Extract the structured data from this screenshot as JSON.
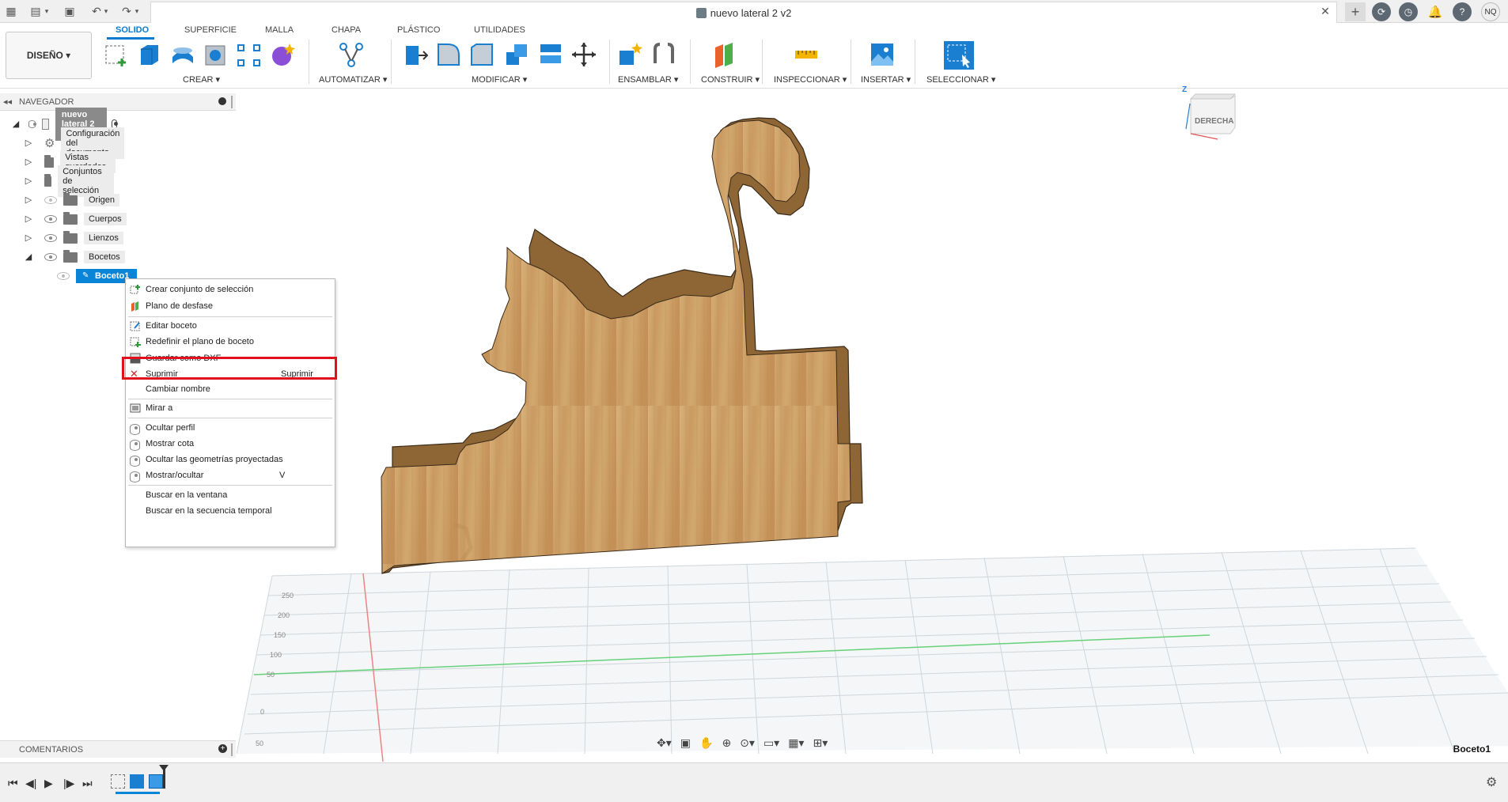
{
  "window": {
    "document_title": "nuevo lateral 2 v2",
    "user_initials": "NQ"
  },
  "toolbar": {
    "workspace": "DISEÑO ▾",
    "tabs": [
      "SOLIDO",
      "SUPERFICIE",
      "MALLA",
      "CHAPA",
      "PLÁSTICO",
      "UTILIDADES"
    ],
    "groups": [
      "CREAR ▾",
      "AUTOMATIZAR ▾",
      "MODIFICAR ▾",
      "ENSAMBLAR ▾",
      "CONSTRUIR ▾",
      "INSPECCIONAR ▾",
      "INSERTAR ▾",
      "SELECCIONAR ▾"
    ]
  },
  "navigator": {
    "title": "NAVEGADOR",
    "root": "nuevo lateral 2 v2",
    "items": [
      "Configuración del documento",
      "Vistas guardadas",
      "Conjuntos de selección",
      "Origen",
      "Cuerpos",
      "Lienzos",
      "Bocetos"
    ],
    "sketch": "Boceto1"
  },
  "context_menu": {
    "items": [
      {
        "label": "Crear conjunto de selección",
        "shortcut": ""
      },
      {
        "label": "Plano de desfase",
        "shortcut": ""
      },
      {
        "label": "Editar boceto",
        "shortcut": ""
      },
      {
        "label": "Redefinir el plano de boceto",
        "shortcut": ""
      },
      {
        "label": "Guardar como DXF",
        "shortcut": ""
      },
      {
        "label": "Suprimir",
        "shortcut": "Suprimir"
      },
      {
        "label": "Cambiar nombre",
        "shortcut": ""
      },
      {
        "label": "Mirar a",
        "shortcut": ""
      },
      {
        "label": "Ocultar perfil",
        "shortcut": ""
      },
      {
        "label": "Mostrar cota",
        "shortcut": ""
      },
      {
        "label": "Ocultar las geometrías proyectadas",
        "shortcut": ""
      },
      {
        "label": "Mostrar/ocultar",
        "shortcut": "V"
      },
      {
        "label": "Buscar en la ventana",
        "shortcut": ""
      },
      {
        "label": "Buscar en la secuencia temporal",
        "shortcut": ""
      }
    ]
  },
  "comments": {
    "title": "COMENTARIOS"
  },
  "viewcube": {
    "face": "DERECHA",
    "axis": "Z"
  },
  "status": {
    "active_sketch": "Boceto1"
  },
  "grid_labels": [
    "250",
    "200",
    "150",
    "100",
    "50",
    "0",
    "50"
  ],
  "colors": {
    "accent": "#0a7bd1",
    "highlight": "#e0111d",
    "wood": "#c9a06a"
  }
}
